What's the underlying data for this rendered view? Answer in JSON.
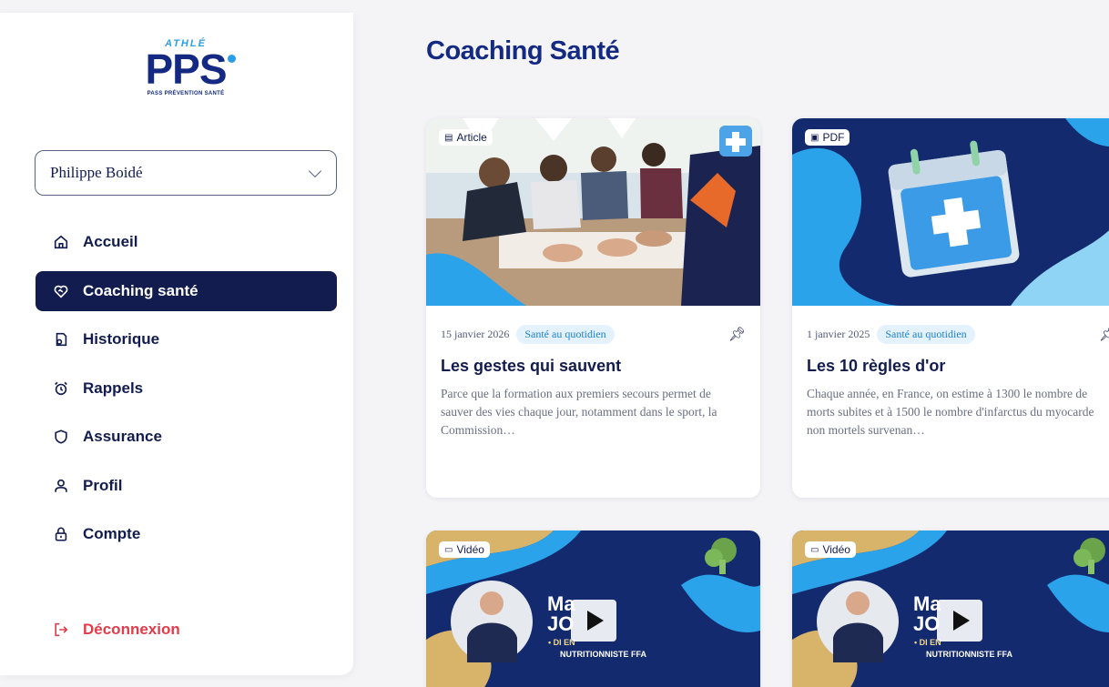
{
  "sidebar": {
    "logo": {
      "top": "ATHLÉ",
      "main": "PPS",
      "sub": "PASS PRÉVENTION SANTÉ"
    },
    "user_select": {
      "value": "Philippe Boidé"
    },
    "nav": [
      {
        "label": "Accueil",
        "icon": "home-icon",
        "active": false
      },
      {
        "label": "Coaching santé",
        "icon": "heart-handshake-icon",
        "active": true
      },
      {
        "label": "Historique",
        "icon": "history-document-icon",
        "active": false
      },
      {
        "label": "Rappels",
        "icon": "alarm-clock-icon",
        "active": false
      },
      {
        "label": "Assurance",
        "icon": "shield-icon",
        "active": false
      },
      {
        "label": "Profil",
        "icon": "user-icon",
        "active": false
      },
      {
        "label": "Compte",
        "icon": "lock-icon",
        "active": false
      }
    ],
    "logout": {
      "label": "Déconnexion",
      "icon": "logout-icon",
      "color": "#e23b4a"
    }
  },
  "main": {
    "title": "Coaching Santé",
    "cards": [
      {
        "type": "Article",
        "date": "15 janvier 2026",
        "tag": "Santé au quotidien",
        "title": "Les gestes qui sauvent",
        "excerpt": "Parce que la formation aux premiers secours permet de sauver des vies chaque jour, notamment dans le sport, la Commission…"
      },
      {
        "type": "PDF",
        "date": "1 janvier 2025",
        "tag": "Santé au quotidien",
        "title": "Les 10 règles d'or",
        "excerpt": "Chaque année, en France, on estime à 1300 le nombre de morts subites et à 1500 le nombre d'infarctus du myocarde non mortels survenan…"
      },
      {
        "type": "Vidéo",
        "overlay_name": "Ma JO",
        "overlay_role": "NUTRITIONNISTE FFA",
        "overlay_prefix": "• DI EN"
      },
      {
        "type": "Vidéo",
        "overlay_name": "Ma JO",
        "overlay_role": "NUTRITIONNISTE FFA",
        "overlay_prefix": "• DI EN"
      }
    ]
  },
  "colors": {
    "primary": "#121c4e",
    "brand_blue": "#142a82",
    "accent": "#2a9ee6",
    "danger": "#e23b4a",
    "tag_bg": "#e4f2fd"
  }
}
